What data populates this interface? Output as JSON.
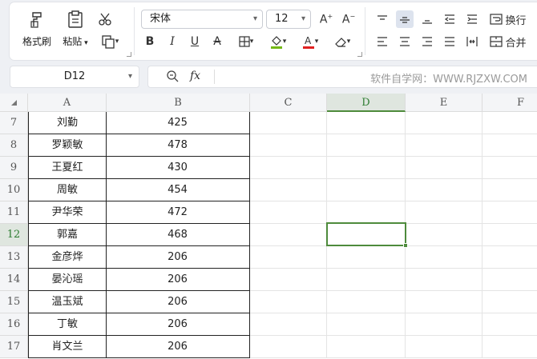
{
  "toolbar": {
    "format_painter_label": "格式刷",
    "paste_label": "粘贴",
    "font_name": "宋体",
    "font_size": "12",
    "wrap_label": "换行",
    "merge_label": "合并",
    "font_color": "#e02020",
    "fill_color": "#74b816"
  },
  "formula_bar": {
    "name_box": "D12",
    "fx_label": "fx",
    "watermark": "软件自学网：WWW.RJZXW.COM"
  },
  "sheet": {
    "columns": [
      "A",
      "B",
      "C",
      "D",
      "E",
      "F"
    ],
    "active_column": "D",
    "active_row": "12",
    "rows": [
      {
        "num": "7",
        "name": "刘勤",
        "score": "425"
      },
      {
        "num": "8",
        "name": "罗颖敏",
        "score": "478"
      },
      {
        "num": "9",
        "name": "王夏红",
        "score": "430"
      },
      {
        "num": "10",
        "name": "周敏",
        "score": "454"
      },
      {
        "num": "11",
        "name": "尹华荣",
        "score": "472"
      },
      {
        "num": "12",
        "name": "郭嘉",
        "score": "468"
      },
      {
        "num": "13",
        "name": "金彦烨",
        "score": "206"
      },
      {
        "num": "14",
        "name": "晏沁瑶",
        "score": "206"
      },
      {
        "num": "15",
        "name": "温玉斌",
        "score": "206"
      },
      {
        "num": "16",
        "name": "丁敏",
        "score": "206"
      },
      {
        "num": "17",
        "name": "肖文兰",
        "score": "206"
      }
    ]
  }
}
